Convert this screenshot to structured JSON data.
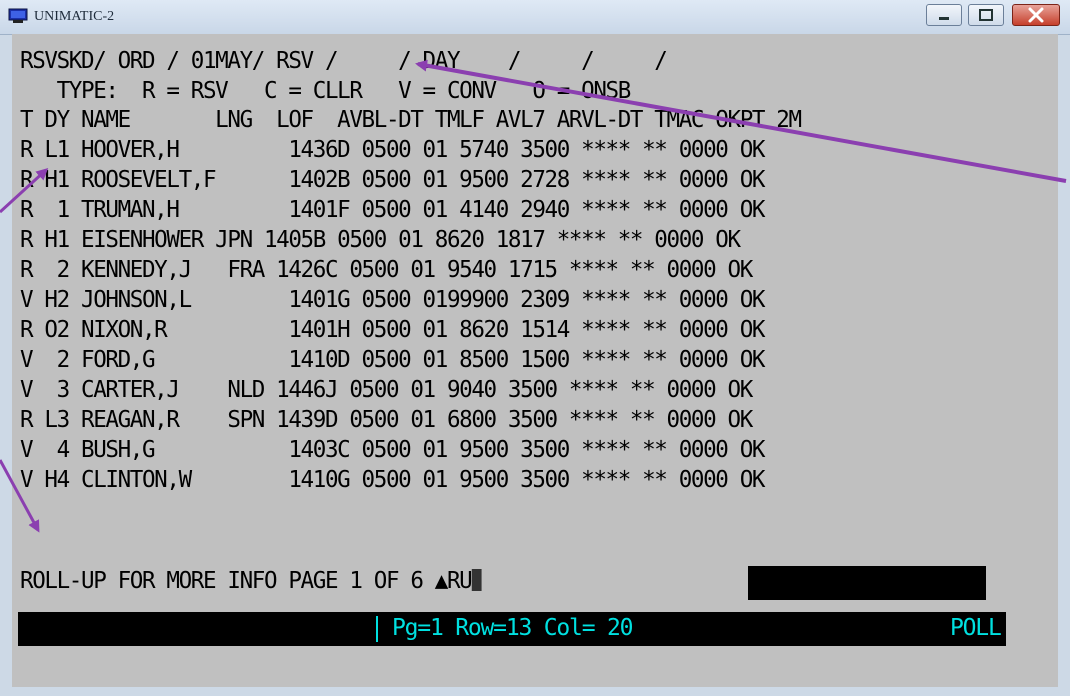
{
  "window": {
    "title": "UNIMATIC-2"
  },
  "screen": {
    "header": "RSVSKD/ ORD / 01MAY/ RSV /     / DAY    /     /     /",
    "legend": "   TYPE:  R = RSV   C = CLLR   V = CONV   O = ONSB",
    "columns": "T DY NAME       LNG  LOF  AVBL-DT TMLF AVL7 ARVL-DT TMAC OKPT 2M",
    "rows": [
      "R L1 HOOVER,H         1436D 0500 01 5740 3500 **** ** 0000 OK",
      "R H1 ROOSEVELT,F      1402B 0500 01 9500 2728 **** ** 0000 OK",
      "R  1 TRUMAN,H         1401F 0500 01 4140 2940 **** ** 0000 OK",
      "R H1 EISENHOWER JPN 1405B 0500 01 8620 1817 **** ** 0000 OK",
      "R  2 KENNEDY,J   FRA 1426C 0500 01 9540 1715 **** ** 0000 OK",
      "V H2 JOHNSON,L        1401G 0500 0199900 2309 **** ** 0000 OK",
      "R O2 NIXON,R          1401H 0500 01 8620 1514 **** ** 0000 OK",
      "V  2 FORD,G           1410D 0500 01 8500 1500 **** ** 0000 OK",
      "V  3 CARTER,J    NLD 1446J 0500 01 9040 3500 **** ** 0000 OK",
      "R L3 REAGAN,R    SPN 1439D 0500 01 6800 3500 **** ** 0000 OK",
      "V  4 BUSH,G           1403C 0500 01 9500 3500 **** ** 0000 OK",
      "V H4 CLINTON,W        1410G 0500 01 9500 3500 **** ** 0000 OK"
    ],
    "footer": "ROLL-UP FOR MORE INFO PAGE 1 OF 6 ▲RU"
  },
  "status_bar": {
    "position": "Pg=1 Row=13 Col= 20",
    "mode": "POLL"
  },
  "colors": {
    "screen_bg": "#c0c0c0",
    "status_text": "#00e0e0",
    "annotation_arrow": "#8b3fb0"
  }
}
